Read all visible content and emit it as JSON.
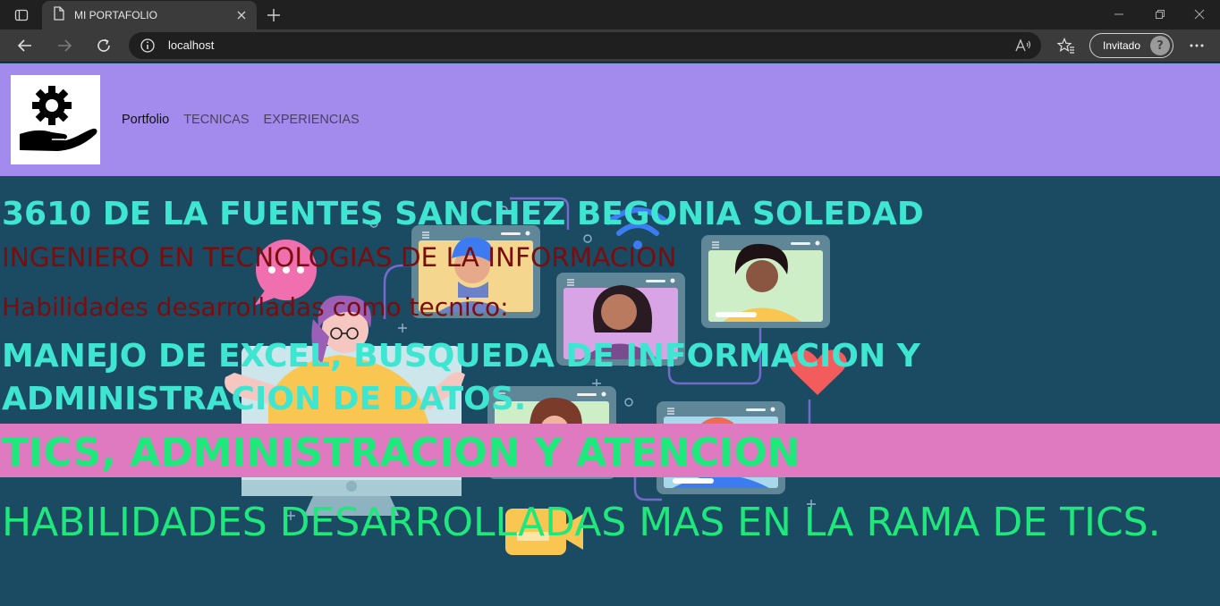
{
  "browser": {
    "tab_title": "MI PORTAFOLIO",
    "address": "localhost",
    "profile_label": "Invitado"
  },
  "site": {
    "nav": {
      "items": [
        {
          "label": "Portfolio"
        },
        {
          "label": "TECNICAS"
        },
        {
          "label": "EXPERIENCIAS"
        }
      ]
    }
  },
  "hero": {
    "name": "3610 DE LA FUENTES SANCHEZ BEGONIA SOLEDAD",
    "role": "INGENIERO EN TECNOLOGIAS DE LA INFORMACION",
    "skills_heading": "Habilidades desarrolladas como tecnico:",
    "skills": "MANEJO DE EXCEL, BUSQUEDA DE INFORMACION Y ADMINISTRACION DE DATOS.",
    "band_text": "TICS, ADMINISTRACION Y ATENCION",
    "bottom_text": "HABILIDADES DESARROLLADAS MAS EN LA RAMA DE TICS."
  },
  "colors": {
    "nav_bg": "#a28bec",
    "hero_bg": "#1b4a63",
    "cyan_text": "#3ee6d2",
    "maroon_text": "#7a0d0d",
    "band_bg": "#e07ac0",
    "green_text": "#1ee87c"
  },
  "icons": [
    "sidebar-toggle-icon",
    "page-icon",
    "close-icon",
    "plus-icon",
    "minimize-icon",
    "restore-icon",
    "window-close-icon",
    "back-icon",
    "forward-icon",
    "refresh-icon",
    "info-icon",
    "read-aloud-icon",
    "favorites-icon",
    "more-icon",
    "gear-hand-logo"
  ]
}
